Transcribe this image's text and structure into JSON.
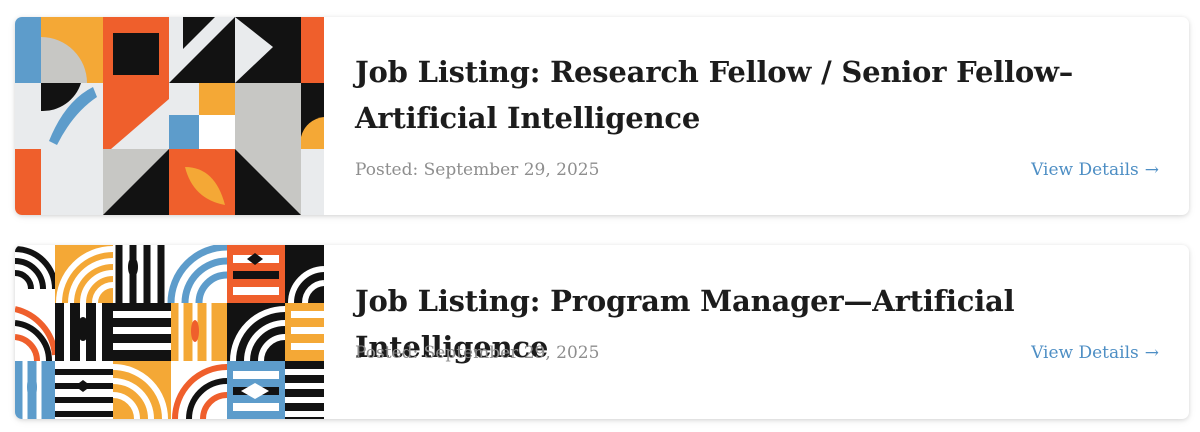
{
  "listings": [
    {
      "title": "Job Listing: Research Fellow / Senior Fellow– Artificial Intelligence",
      "posted": "Posted: September 29, 2025",
      "details_label": "View Details",
      "details_arrow": "→",
      "thumbnail_icon": "geometric-pattern-image"
    },
    {
      "title": "Job Listing: Program Manager—Artificial Intelligence",
      "posted": "Posted: September 29, 2025",
      "details_label": "View Details",
      "details_arrow": "→",
      "thumbnail_icon": "arcs-stripes-pattern-image"
    }
  ],
  "colors": {
    "orange": "#ef5f2c",
    "amber": "#f4a836",
    "blue": "#5d9ccb",
    "gray": "#c7c7c4",
    "light": "#e9ebed",
    "black": "#121212",
    "link": "#4d8ec4"
  }
}
